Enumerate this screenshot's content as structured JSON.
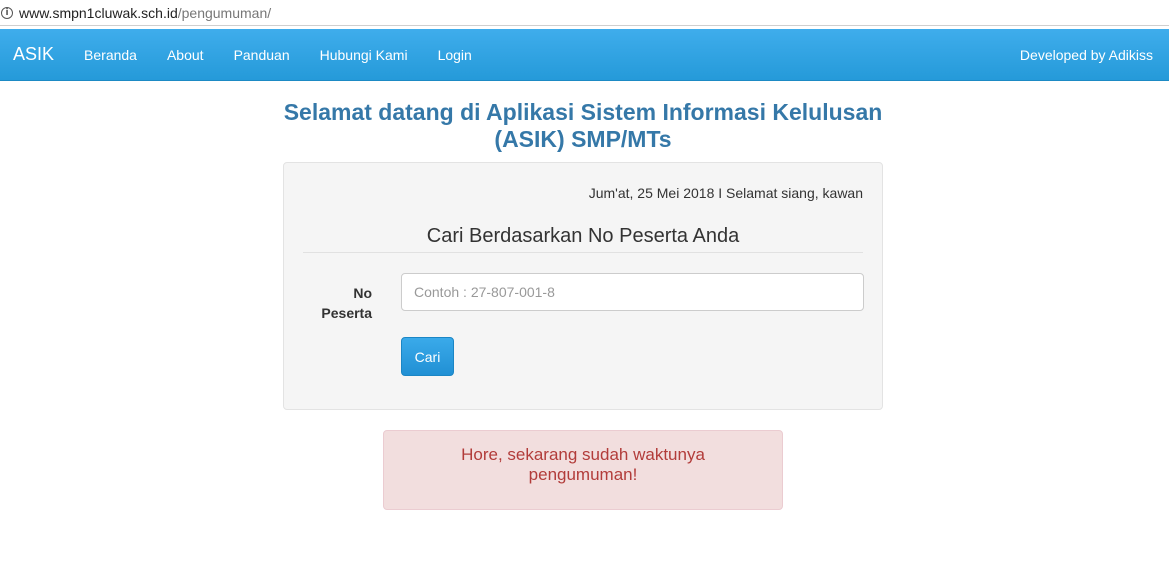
{
  "browser": {
    "url_host": "www.smpn1cluwak.sch.id",
    "url_path": "/pengumuman/"
  },
  "navbar": {
    "brand": "ASIK",
    "items": [
      "Beranda",
      "About",
      "Panduan",
      "Hubungi Kami",
      "Login"
    ],
    "right_text": "Developed by Adikiss",
    "color": "#2fa4e7"
  },
  "page": {
    "title": "Selamat datang di Aplikasi Sistem Informasi Kelulusan (ASIK) SMP/MTs"
  },
  "search_panel": {
    "date_greeting": "Jum'at, 25 Mei 2018 I Selamat siang, kawan",
    "legend": "Cari Berdasarkan No Peserta Anda",
    "field_label": "No Peserta",
    "input_value": "",
    "input_placeholder": "Contoh : 27-807-001-8",
    "button_label": "Cari"
  },
  "alert": {
    "message": "Hore, sekarang sudah waktunya pengumuman!",
    "color": "#b23c3a"
  }
}
